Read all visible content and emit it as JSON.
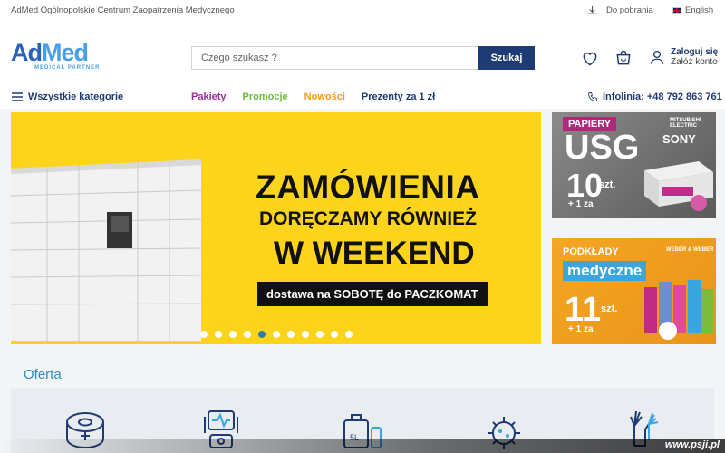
{
  "topbar": {
    "company": "AdMed Ogólnopolskie Centrum Zaopatrzenia Medycznego",
    "downloads": "Do pobrania",
    "language": "English"
  },
  "logo": {
    "brand_ad": "Ad",
    "brand_med": "Med",
    "tagline": "MEDICAL PARTNER"
  },
  "search": {
    "placeholder": "Czego szukasz ?",
    "button": "Szukaj"
  },
  "account": {
    "login": "Zaloguj się",
    "register": "Załóż konto"
  },
  "nav": {
    "all_categories": "Wszystkie kategorie",
    "links": [
      {
        "label": "Pakiety",
        "color": "#9b2c9a"
      },
      {
        "label": "Promocje",
        "color": "#6cbd3b"
      },
      {
        "label": "Nowości",
        "color": "#f39c12"
      },
      {
        "label": "Prezenty za 1 zł",
        "color": "#1f3b73"
      }
    ],
    "phone": "Infolinia: +48 792 863 761"
  },
  "hero": {
    "line1": "ZAMÓWIENIA",
    "line2": "DORĘCZAMY RÓWNIEŻ",
    "line3": "W WEEKEND",
    "line4": "dostawa na SOBOTĘ do PACZKOMAT",
    "slides": 11,
    "active_slide": 5
  },
  "promo1": {
    "tag": "PAPIERY",
    "title": "USG",
    "count": "10",
    "unit": "szt.",
    "bonus": "+ 1 za",
    "brand1": "SONY",
    "brand2": "MITSUBISHI ELECTRIC"
  },
  "promo2": {
    "tag": "PODKŁADY",
    "title": "medyczne",
    "count": "11",
    "unit": "szt.",
    "bonus": "+ 1 za",
    "brand": "WEBER & WEBER"
  },
  "oferta": {
    "title": "Oferta"
  },
  "watermark": "www.psji.pl",
  "colors": {
    "primary": "#1f3b73",
    "accent": "#2e8bc0",
    "hero_bg": "#fdd41c"
  }
}
